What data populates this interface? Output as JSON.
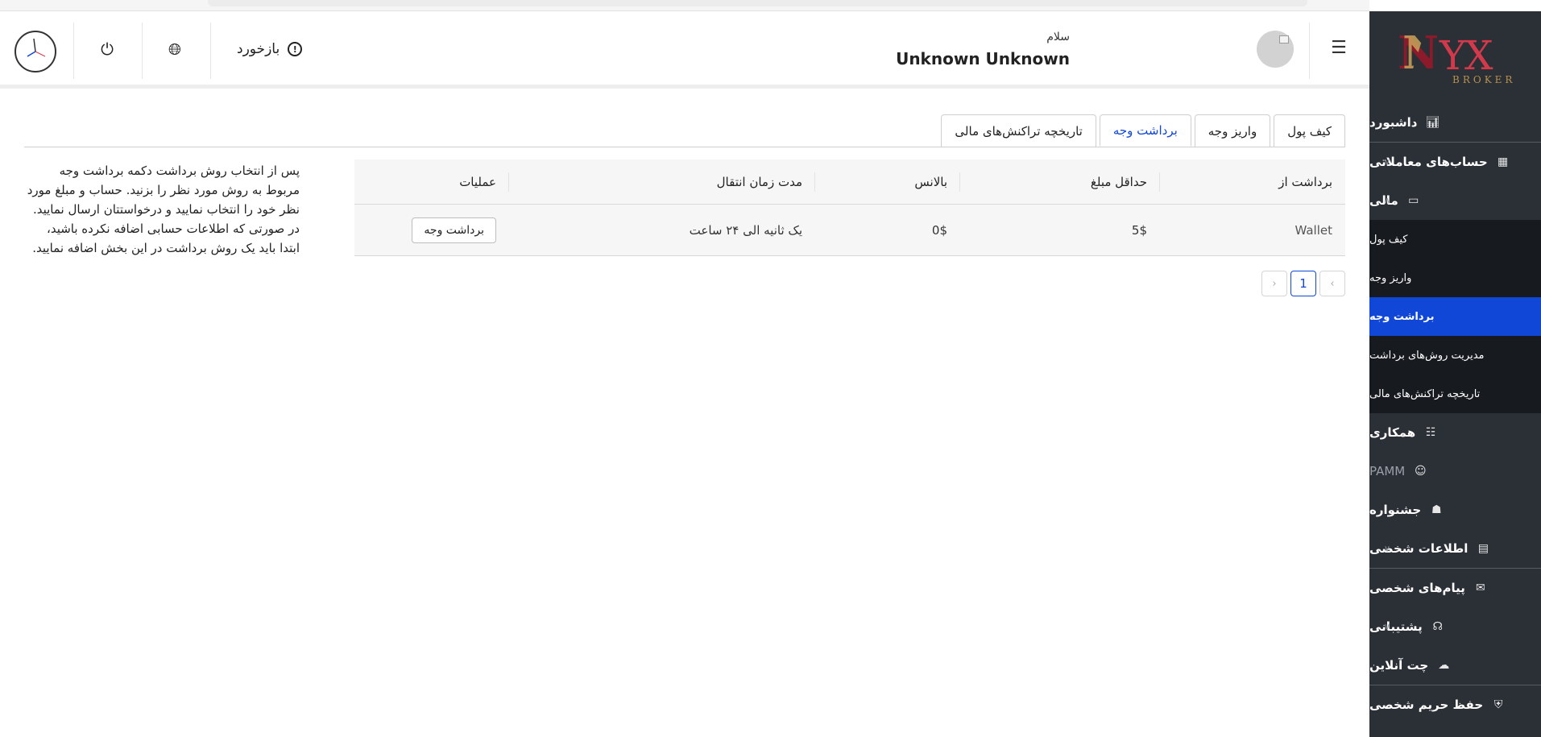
{
  "header": {
    "greeting": "سلام",
    "username": "Unknown Unknown",
    "feedback_label": "بازخورد"
  },
  "logo": {
    "letters": "NYX",
    "subtitle": "BROKER"
  },
  "sidebar": {
    "items": [
      {
        "label": "داشبورد",
        "icon": "chart-icon"
      },
      {
        "label": "حساب‌های معاملاتی",
        "icon": "grid-icon",
        "has_chevron": true
      },
      {
        "label": "مالی",
        "icon": "wallet-icon",
        "expanded": true
      }
    ],
    "finance_sub": [
      {
        "label": "کیف پول"
      },
      {
        "label": "واریز وجه"
      },
      {
        "label": "برداشت وجه",
        "active": true
      },
      {
        "label": "مدیریت روش‌های برداشت"
      },
      {
        "label": "تاریخچه تراکنش‌های مالی"
      }
    ],
    "items_after": [
      {
        "label": "همکاری",
        "icon": "network-icon"
      },
      {
        "label": "PAMM",
        "icon": "users-icon"
      },
      {
        "label": "جشنواره",
        "icon": "gift-icon"
      },
      {
        "label": "اطلاعات شخصی",
        "icon": "id-card-icon",
        "has_chevron": true
      },
      {
        "label": "پیام‌های شخصی",
        "icon": "mail-icon"
      },
      {
        "label": "پشتیبانی",
        "icon": "headset-icon",
        "has_chevron": true
      },
      {
        "label": "چت آنلاین",
        "icon": "chat-icon"
      },
      {
        "label": "حفظ حریم شخصی",
        "icon": "shield-icon"
      }
    ]
  },
  "tabs": [
    {
      "label": "کیف پول"
    },
    {
      "label": "واریز وجه"
    },
    {
      "label": "برداشت وجه",
      "active": true
    },
    {
      "label": "تاریخچه تراکنش‌های مالی"
    }
  ],
  "table": {
    "columns": [
      "برداشت از",
      "حداقل مبلغ",
      "بالانس",
      "مدت زمان انتقال",
      "عملیات"
    ],
    "rows": [
      {
        "source": "Wallet",
        "min": "5$",
        "balance": "0$",
        "duration": "یک ثانیه الی ۲۴ ساعت",
        "action": "برداشت وجه"
      }
    ]
  },
  "pagination": {
    "current": "1"
  },
  "note": "پس از انتخاب روش برداشت دکمه برداشت وجه مربوط به روش مورد نظر را بزنید. حساب و مبلغ مورد نظر خود را انتخاب نمایید و درخواستتان ارسال نمایید. در صورتی که اطلاعات حسابی اضافه نکرده باشید، ابتدا باید یک روش برداشت در این بخش اضافه نمایید.",
  "colors": {
    "sidebar_bg": "#2b2f36",
    "submenu_bg": "#171a1f",
    "accent": "#1147d7"
  }
}
